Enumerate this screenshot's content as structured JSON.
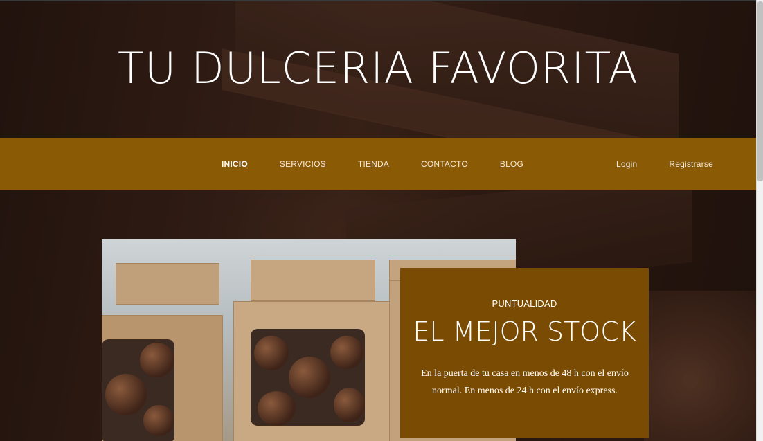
{
  "hero": {
    "title": "TU DULCERIA FAVORITA"
  },
  "nav": {
    "links": [
      {
        "label": "INICIO",
        "active": true
      },
      {
        "label": "SERVICIOS",
        "active": false
      },
      {
        "label": "TIENDA",
        "active": false
      },
      {
        "label": "CONTACTO",
        "active": false
      },
      {
        "label": "BLOG",
        "active": false
      }
    ],
    "login": "Login",
    "register": "Registrarse"
  },
  "feature": {
    "kicker": "PUNTUALIDAD",
    "title": "EL MEJOR STOCK",
    "text": "En la puerta de tu casa en menos de 48 h con el envío normal. En menos de 24 h con el envío express."
  },
  "colors": {
    "navbar": "#8b5a05",
    "card": "#7a4b02",
    "text": "#ffffff"
  }
}
